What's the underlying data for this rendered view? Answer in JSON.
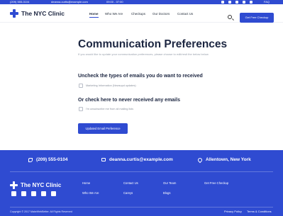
{
  "topbar": {
    "phone": "(209) 555-0104",
    "email": "deanna.curtis@example.com",
    "hours": "09:00 - 07:00",
    "faq": "FAQ",
    "social_icons": [
      "facebook-icon",
      "instagram-icon",
      "linkedin-icon",
      "youtube-icon",
      "twitter-icon"
    ]
  },
  "header": {
    "brand": "The NYC Clinic",
    "nav": [
      "Home",
      "Who We Are",
      "Checkups",
      "Our Doctors",
      "Contact Us"
    ],
    "active_nav": "Home",
    "cta": "Get Free Checkup"
  },
  "main": {
    "title": "Communication Preferences",
    "subtitle": "If you would like to update your communication preferences, please choose to edit/resit the below below",
    "section1_title": "Uncheck the types of emails you do want to received",
    "option1": "Marketing Information (Newsupd updates)",
    "section2_title": "Or check here to never received any emails",
    "option2": "I'm unsubscribe me from all mailing lists",
    "update_button": "Updated Email Preference"
  },
  "footer": {
    "phone": "(209) 555-0104",
    "email": "deanna.curtis@example.com",
    "location": "Allentown, New York",
    "brand": "The NYC Clinic",
    "links": {
      "col1": [
        "Home",
        "Who We Are"
      ],
      "col2": [
        "Contact Us",
        "Careys"
      ],
      "col3": [
        "Our Team",
        "Blogs"
      ],
      "col4": [
        "Get Free Checkup"
      ]
    },
    "copyright": "Copyright © 2017 MakeWebBetter. All Rights Reserved",
    "privacy": "Privacy Policy",
    "terms": "Terms & Conditions"
  },
  "colors": {
    "brand_blue": "#2f4bd1",
    "heading": "#1b2540"
  }
}
